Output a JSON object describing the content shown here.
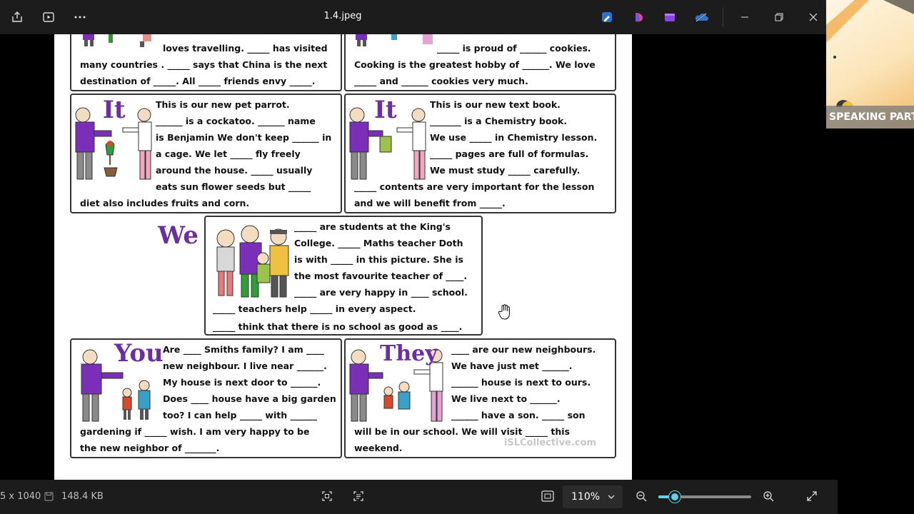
{
  "titlebar": {
    "title": "1.4.jpeg"
  },
  "worksheet": {
    "top_left": [
      "loves travelling. _____ has visited",
      "many countries . _____ says that China is the next",
      "destination of _____. All _____ friends envy _____."
    ],
    "top_right": [
      "_____ is proud of ______ cookies.",
      "Cooking is the greatest hobby of ______. We love",
      "_____ and ______ cookies very much."
    ],
    "parrot": {
      "pronoun": "It",
      "lines": [
        "This is our new pet parrot.",
        "______ is a cockatoo. ______ name",
        "is Benjamin We don't keep ______ in",
        "a cage. We let _____ fly freely",
        "around the house. _____ usually",
        "eats sun flower seeds but _____",
        "diet also includes fruits and corn."
      ]
    },
    "textbook": {
      "pronoun": "It",
      "lines": [
        "This is our new text book.",
        "_______ is a Chemistry book.",
        "We use _____ in Chemistry lesson.",
        "_____ pages are full of formulas.",
        "We must study _____ carefully.",
        "_____ contents are very important for the lesson",
        "and we will benefit from _____."
      ]
    },
    "we": {
      "pronoun": "We",
      "lines": [
        "_____ are students at the King's",
        "College. _____ Maths teacher Doth",
        "is with _____ in this picture. She is",
        "the most favourite teacher of ____.",
        "_____ are very happy in ____ school.",
        "_____ teachers help _____ in every aspect.",
        "_____ think that there is no school as good as ____."
      ]
    },
    "you": {
      "pronoun": "You",
      "lines": [
        "Are ____ Smiths family? I am ____",
        "new neighbour. I live near ______.",
        "My house is next door to ______.",
        "Does ____ house have a big garden",
        "too? I can help _____ with ______",
        "gardening if _____ wish. I am very happy to be",
        "the new neighbor of _______."
      ]
    },
    "they": {
      "pronoun": "They",
      "lines": [
        "____ are our new neighbours.",
        "We have just met ______.",
        "______ house is next to ours.",
        "We live next to ______.",
        "______ have a son. _____ son",
        "will be in our school. We will visit _____ this",
        "weekend."
      ]
    },
    "watermark": "iSLCollective.com"
  },
  "overlay": {
    "label": "SPEAKING PART"
  },
  "statusbar": {
    "dimensions": "5 x 1040",
    "file_size": "148.4 KB",
    "zoom": "110%",
    "zoom_level": 0.18
  },
  "colors": {
    "pronoun": "#6b2fa0",
    "purple_shirt": "#7b2fb8",
    "accent": "#5fd0e6"
  }
}
